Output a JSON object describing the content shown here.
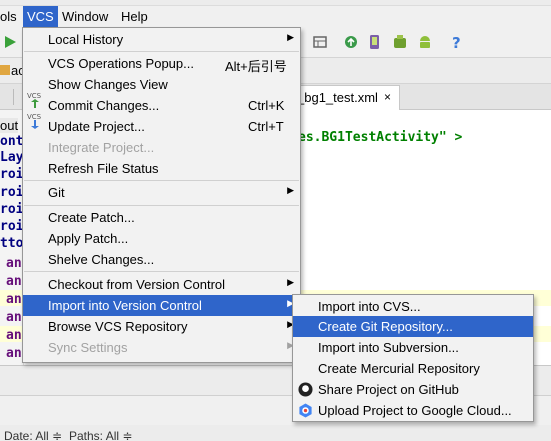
{
  "menubar": {
    "items": [
      "ols",
      "VCS",
      "Window",
      "Help"
    ]
  },
  "tabs": {
    "active_fragment": "_bg1_test.xml",
    "close_glyph": "×"
  },
  "editor": {
    "code_fragment": "es.BG1TestActivity\" >",
    "gutter_fragments": [
      "ont",
      "Lay",
      "roi",
      "roi",
      "roi",
      "roi",
      "tto",
      "an",
      "an",
      "an",
      "an",
      "an",
      "an"
    ],
    "left_label": "out"
  },
  "filterbar": {
    "date": "Date: All ≑",
    "paths": "Paths: All ≑"
  },
  "vcs_menu": {
    "items": [
      {
        "label": "Local History",
        "shortcut": "",
        "submenu": true,
        "disabled": false
      },
      {
        "label": "VCS Operations Popup...",
        "shortcut": "Alt+后引号",
        "submenu": false,
        "disabled": false
      },
      {
        "label": "Show Changes View",
        "shortcut": "",
        "submenu": false,
        "disabled": false
      },
      {
        "label": "Commit Changes...",
        "shortcut": "Ctrl+K",
        "submenu": false,
        "disabled": false
      },
      {
        "label": "Update Project...",
        "shortcut": "Ctrl+T",
        "submenu": false,
        "disabled": false
      },
      {
        "label": "Integrate Project...",
        "shortcut": "",
        "submenu": false,
        "disabled": true
      },
      {
        "label": "Refresh File Status",
        "shortcut": "",
        "submenu": false,
        "disabled": false
      },
      {
        "label": "Git",
        "shortcut": "",
        "submenu": true,
        "disabled": false
      },
      {
        "label": "Create Patch...",
        "shortcut": "",
        "submenu": false,
        "disabled": false
      },
      {
        "label": "Apply Patch...",
        "shortcut": "",
        "submenu": false,
        "disabled": false
      },
      {
        "label": "Shelve Changes...",
        "shortcut": "",
        "submenu": false,
        "disabled": false
      },
      {
        "label": "Checkout from Version Control",
        "shortcut": "",
        "submenu": true,
        "disabled": false
      },
      {
        "label": "Import into Version Control",
        "shortcut": "",
        "submenu": true,
        "disabled": false,
        "selected": true
      },
      {
        "label": "Browse VCS Repository",
        "shortcut": "",
        "submenu": true,
        "disabled": false
      },
      {
        "label": "Sync Settings",
        "shortcut": "",
        "submenu": true,
        "disabled": true
      }
    ]
  },
  "import_submenu": {
    "items": [
      {
        "label": "Import into CVS...",
        "icon": ""
      },
      {
        "label": "Create Git Repository...",
        "icon": "",
        "selected": true
      },
      {
        "label": "Import into Subversion...",
        "icon": ""
      },
      {
        "label": "Create Mercurial Repository",
        "icon": ""
      },
      {
        "label": "Share Project on GitHub",
        "icon": "github-icon"
      },
      {
        "label": "Upload Project to Google Cloud...",
        "icon": "google-cloud-icon"
      }
    ]
  },
  "colors": {
    "selection": "#2f65ca",
    "menu_bg": "#f2f2f2",
    "disabled_text": "#a2a2a2"
  }
}
